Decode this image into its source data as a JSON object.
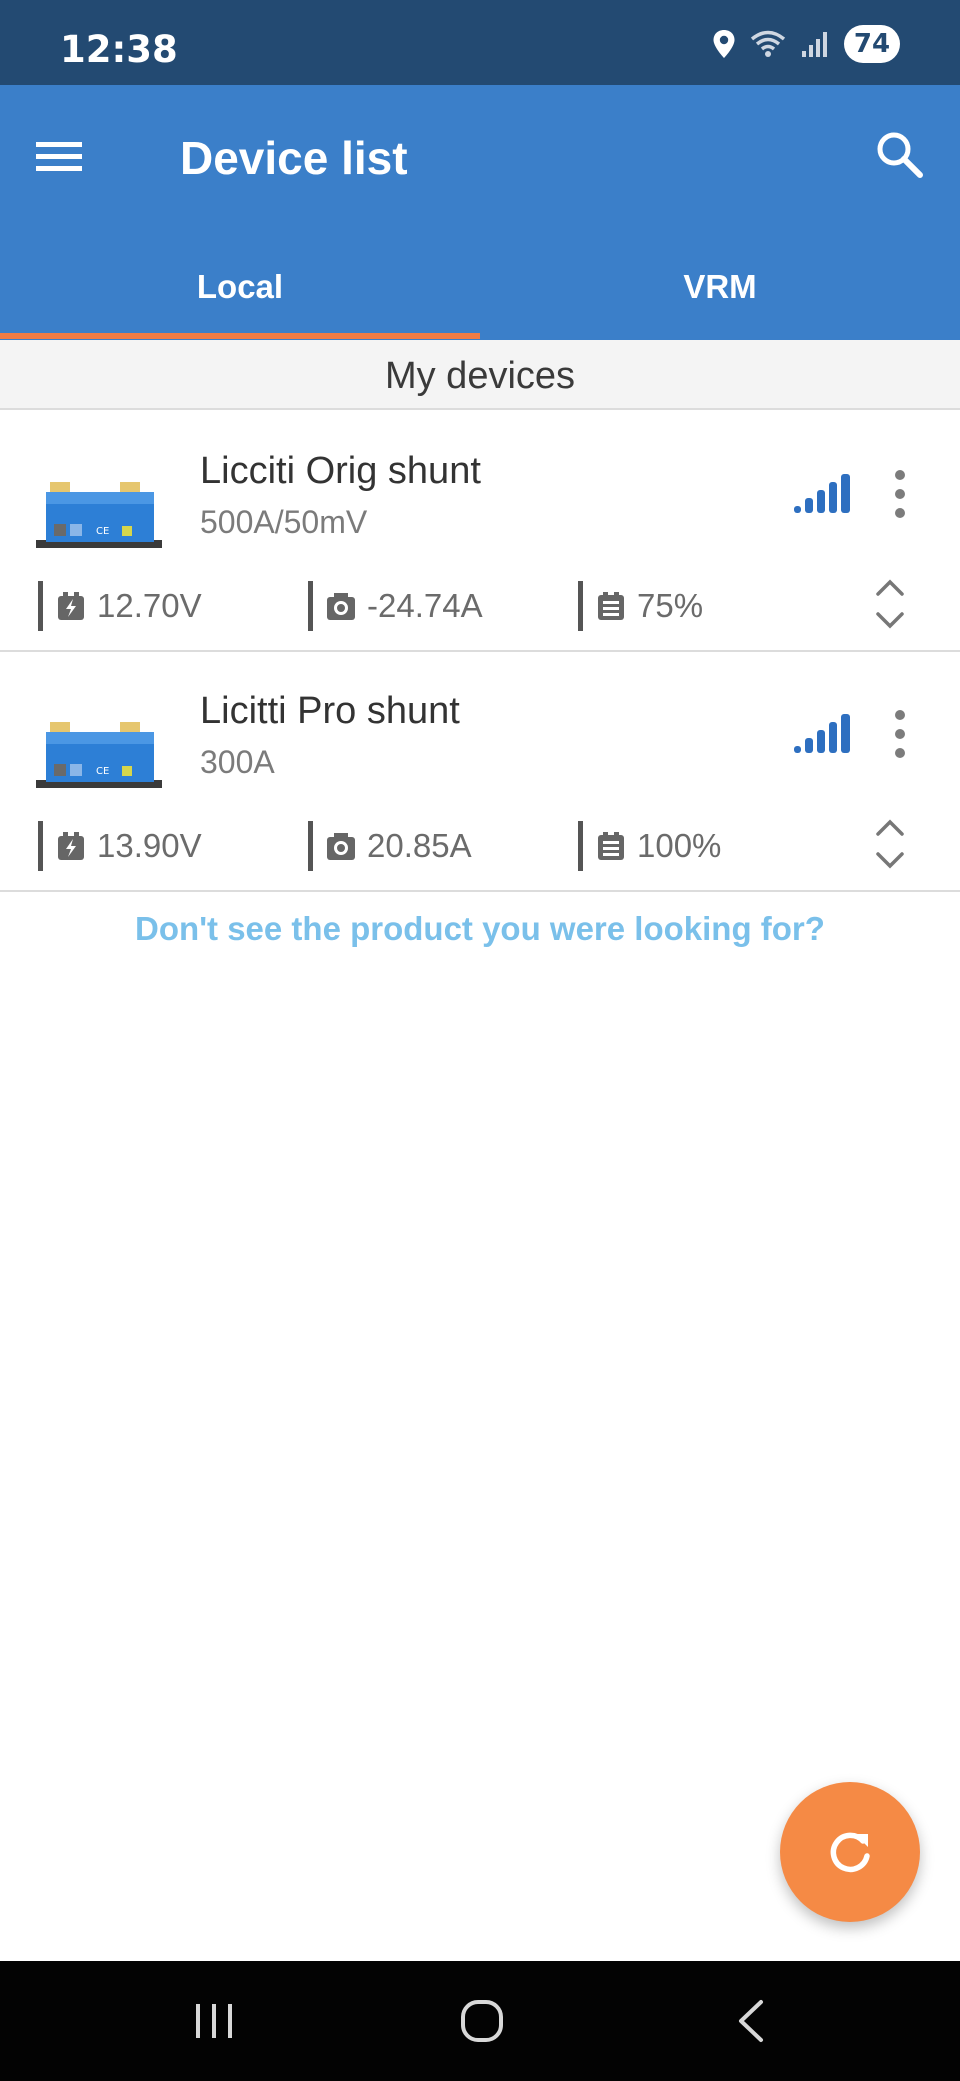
{
  "status_bar": {
    "time": "12:38",
    "battery": "74",
    "icons": [
      "location-icon",
      "wifi-icon",
      "cell-signal-icon",
      "battery-icon"
    ]
  },
  "app_bar": {
    "title": "Device list",
    "tabs": [
      {
        "label": "Local",
        "selected": true
      },
      {
        "label": "VRM",
        "selected": false
      }
    ],
    "colors": {
      "primary": "#3b7fc9",
      "status": "#234a72",
      "accent": "#f07c45"
    }
  },
  "section_header": "My devices",
  "devices": [
    {
      "name": "Licciti Orig shunt",
      "subtitle": "500A/50mV",
      "voltage": "12.70V",
      "current": "-24.74A",
      "state_of_charge": "75%",
      "signal_icon": "signal-strength-icon"
    },
    {
      "name": "Licitti Pro shunt",
      "subtitle": "300A",
      "voltage": "13.90V",
      "current": "20.85A",
      "state_of_charge": "100%",
      "signal_icon": "signal-strength-icon"
    }
  ],
  "help_link": "Don't see the product you were looking for?",
  "fab_icon": "refresh-icon",
  "nav_bar_icons": [
    "recents-icon",
    "home-icon",
    "back-icon"
  ]
}
